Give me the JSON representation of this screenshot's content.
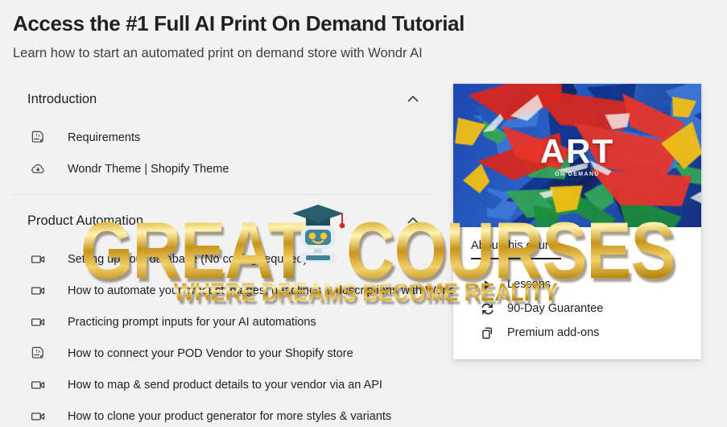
{
  "header": {
    "title": "Access the #1 Full AI Print On Demand Tutorial",
    "subtitle": "Learn how to start an automated print on demand store with Wondr AI"
  },
  "curriculum": {
    "sections": [
      {
        "title": "Introduction",
        "expanded": true,
        "toggle_icon": "chevron-up-icon",
        "lessons": [
          {
            "label": "Requirements",
            "icon": "text-document-icon"
          },
          {
            "label": "Wondr Theme | Shopify Theme",
            "icon": "cloud-download-icon"
          }
        ]
      },
      {
        "title": "Product Automation",
        "expanded": true,
        "toggle_icon": "chevron-up-icon",
        "lessons": [
          {
            "label": "Setting up your database (No coding required)",
            "icon": "video-camera-icon"
          },
          {
            "label": "How to automate your product images, headlines & descriptions with Wondr AI",
            "icon": "video-camera-icon"
          },
          {
            "label": "Practicing prompt inputs for your AI automations",
            "icon": "video-camera-icon"
          },
          {
            "label": "How to connect your POD Vendor to your Shopify store",
            "icon": "text-document-icon"
          },
          {
            "label": "How to map & send product details to your vendor via an API",
            "icon": "video-camera-icon"
          },
          {
            "label": "How to clone your product generator for more styles & variants",
            "icon": "video-camera-icon"
          }
        ]
      }
    ]
  },
  "course_card": {
    "artwork": {
      "wordmark": "ART",
      "sub_wordmark": "ON DEMAND",
      "alt": "abstract red blue yellow green acrylic paint artwork"
    },
    "tab_label": "About this course",
    "features": [
      {
        "label": "Lessons",
        "icon": "play-triangle-icon"
      },
      {
        "label": "90-Day Guarantee",
        "icon": "refresh-cycle-icon"
      },
      {
        "label": "Premium add-ons",
        "icon": "copy-stack-icon"
      }
    ]
  },
  "watermark": {
    "word_one": "GREAT",
    "word_two": "COURSES",
    "tagline": "WHERE DREAMS BECOME REALITY",
    "mascot": "graduation-cap-robot-icon",
    "gold_color": "#d4a017"
  }
}
